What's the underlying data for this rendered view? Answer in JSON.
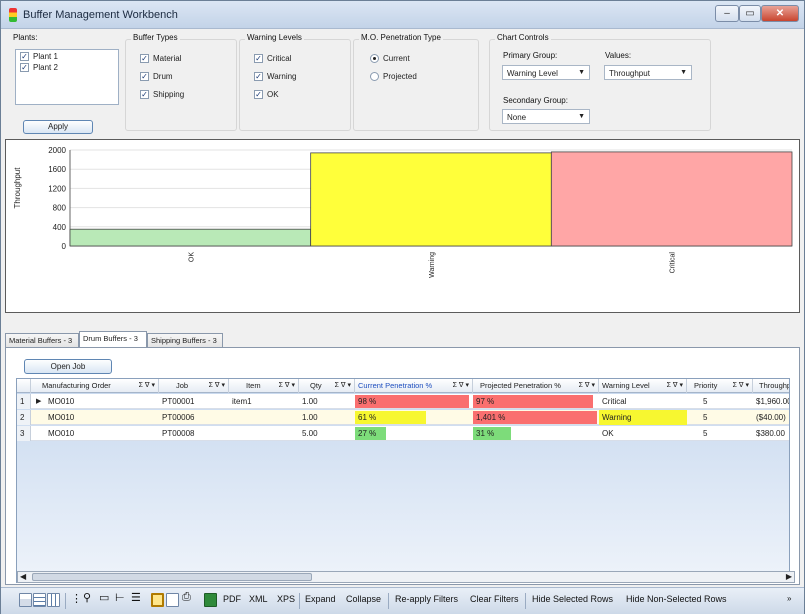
{
  "window": {
    "title": "Buffer Management Workbench"
  },
  "plants": {
    "label": "Plants:",
    "items": [
      {
        "label": "Plant 1",
        "checked": true
      },
      {
        "label": "Plant 2",
        "checked": true
      }
    ],
    "apply_label": "Apply"
  },
  "buffer_types": {
    "label": "Buffer Types",
    "items": [
      {
        "label": "Material"
      },
      {
        "label": "Drum"
      },
      {
        "label": "Shipping"
      }
    ]
  },
  "warning_levels": {
    "label": "Warning Levels",
    "items": [
      {
        "label": "Critical"
      },
      {
        "label": "Warning"
      },
      {
        "label": "OK"
      }
    ]
  },
  "penetration_type": {
    "label": "M.O. Penetration Type",
    "options": [
      {
        "label": "Current",
        "selected": true
      },
      {
        "label": "Projected",
        "selected": false
      }
    ]
  },
  "chart_controls": {
    "label": "Chart Controls",
    "primary_group_label": "Primary Group:",
    "primary_group_value": "Warning Level",
    "values_label": "Values:",
    "values_value": "Throughput",
    "secondary_group_label": "Secondary Group:",
    "secondary_group_value": "None"
  },
  "chart_data": {
    "type": "bar",
    "ylabel": "Throughput",
    "ylim": [
      0,
      2000
    ],
    "yticks": [
      0,
      400,
      800,
      1200,
      1600,
      2000
    ],
    "categories": [
      "OK",
      "Warning",
      "Critical"
    ],
    "values": [
      350,
      1940,
      1960
    ],
    "colors": [
      "#b9e9b7",
      "#ffff3a",
      "#ffa6a6"
    ],
    "grid": true
  },
  "tabs": [
    {
      "label": "Material Buffers - 3"
    },
    {
      "label": "Drum Buffers - 3"
    },
    {
      "label": "Shipping Buffers - 3"
    }
  ],
  "open_job_label": "Open Job",
  "grid": {
    "columns": [
      "Manufacturing Order",
      "Job",
      "Item",
      "Qty",
      "Current Penetration %",
      "Projected Penetration %",
      "Warning Level",
      "Priority",
      "Throughput"
    ],
    "column_ops": "Σ ∇ ▾",
    "rows": [
      {
        "num": "1",
        "mo": "MO010",
        "job": "PT00001",
        "item": "item1",
        "qty": "1.00",
        "cur_pen": "98 %",
        "cur_pct": 98,
        "proj_pen": "97 %",
        "proj_pct": 97,
        "level": "Critical",
        "priority": "5",
        "throughput": "$1,960.00"
      },
      {
        "num": "2",
        "mo": "MO010",
        "job": "PT00006",
        "item": "",
        "qty": "1.00",
        "cur_pen": "61 %",
        "cur_pct": 61,
        "proj_pen": "1,401 %",
        "proj_pct": 100,
        "level": "Warning",
        "priority": "5",
        "throughput": "($40.00)"
      },
      {
        "num": "3",
        "mo": "MO010",
        "job": "PT00008",
        "item": "",
        "qty": "5.00",
        "cur_pen": "27 %",
        "cur_pct": 27,
        "proj_pen": "31 %",
        "proj_pct": 31,
        "level": "OK",
        "priority": "5",
        "throughput": "$380.00"
      }
    ]
  },
  "toolbar": {
    "pdf": "PDF",
    "xml": "XML",
    "xps": "XPS",
    "expand": "Expand",
    "collapse": "Collapse",
    "reapply": "Re-apply Filters",
    "clear": "Clear Filters",
    "hide_selected": "Hide Selected Rows",
    "hide_non_selected": "Hide Non-Selected Rows"
  }
}
